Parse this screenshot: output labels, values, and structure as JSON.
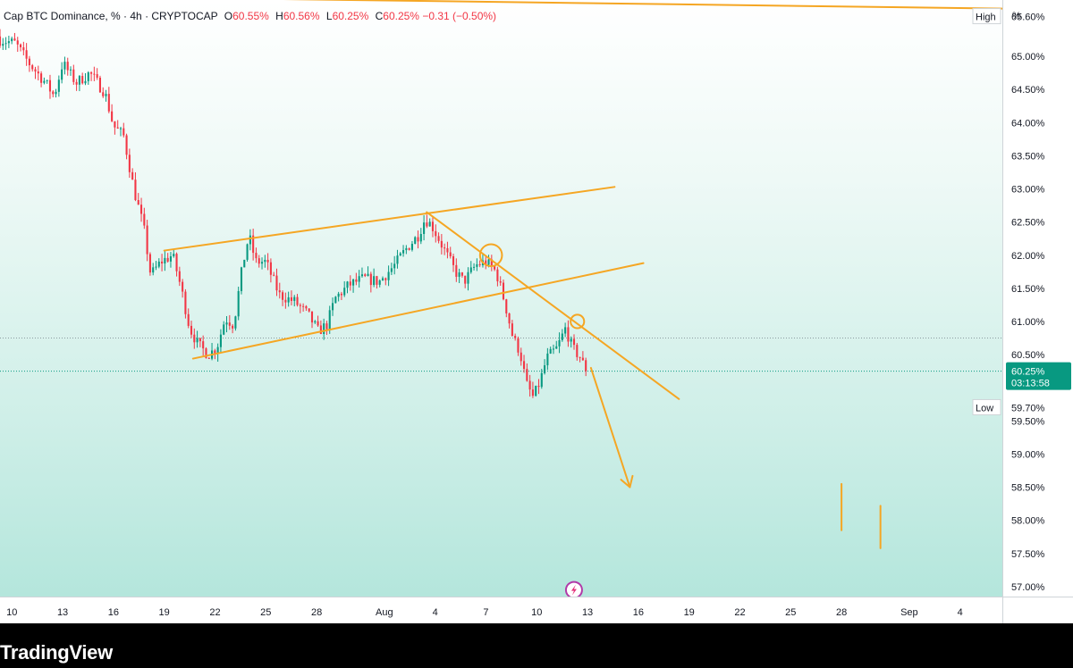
{
  "legend": {
    "title": "Cap BTC Dominance, % · 4h · CRYPTOCAP",
    "open_key": "O",
    "open": "60.55%",
    "high_key": "H",
    "high": "60.56%",
    "low_key": "L",
    "low": "60.25%",
    "close_key": "C",
    "close": "60.25%",
    "change": "−0.31 (−0.50%)"
  },
  "price_axis": {
    "unit": "%",
    "ticks": [
      "65.60%",
      "65.00%",
      "64.50%",
      "64.00%",
      "63.50%",
      "63.00%",
      "62.50%",
      "62.00%",
      "61.50%",
      "61.00%",
      "60.50%",
      "59.70%",
      "59.50%",
      "59.00%",
      "58.50%",
      "58.00%",
      "57.50%",
      "57.00%"
    ],
    "tick_values": [
      65.6,
      65.0,
      64.5,
      64.0,
      63.5,
      63.0,
      62.5,
      62.0,
      61.5,
      61.0,
      60.5,
      59.7,
      59.5,
      59.0,
      58.5,
      58.0,
      57.5,
      57.0
    ],
    "high_tag": {
      "label": "High",
      "value": 65.6
    },
    "low_tag": {
      "label": "Low",
      "value": 59.7
    },
    "last_price_tag": {
      "price": "60.25%",
      "countdown": "03:13:58",
      "value": 60.25,
      "color": "#089981"
    }
  },
  "time_axis": {
    "labels": [
      "10",
      "13",
      "16",
      "19",
      "22",
      "25",
      "28",
      "Aug",
      "4",
      "7",
      "10",
      "13",
      "16",
      "19",
      "22",
      "25",
      "28",
      "Sep",
      "4"
    ],
    "label_days": [
      10,
      13,
      16,
      19,
      22,
      25,
      28,
      32,
      35,
      38,
      41,
      44,
      47,
      50,
      53,
      56,
      59,
      63,
      66
    ]
  },
  "branding": {
    "text": "TradingView"
  },
  "colors": {
    "up": "#089981",
    "down": "#f23645",
    "drawing": "#f5a623",
    "last_price": "#089981"
  },
  "chart_data": {
    "type": "candlestick",
    "title": "Cap BTC Dominance, % · 4h · CRYPTOCAP",
    "ylabel": "%",
    "ylim": [
      56.85,
      65.85
    ],
    "xlim": [
      9.3,
      68.5
    ],
    "x_unit": "day of July (Aug 1 = 32)",
    "path_points": [
      [
        9.3,
        65.25
      ],
      [
        10.2,
        65.2
      ],
      [
        11.0,
        64.9
      ],
      [
        12.0,
        64.6
      ],
      [
        12.5,
        64.4
      ],
      [
        13.0,
        64.9
      ],
      [
        13.8,
        64.6
      ],
      [
        14.6,
        64.75
      ],
      [
        15.5,
        64.45
      ],
      [
        16.0,
        63.95
      ],
      [
        16.6,
        63.8
      ],
      [
        17.2,
        63.0
      ],
      [
        17.8,
        62.4
      ],
      [
        18.2,
        61.7
      ],
      [
        18.8,
        61.9
      ],
      [
        19.5,
        62.0
      ],
      [
        20.0,
        61.5
      ],
      [
        20.5,
        60.9
      ],
      [
        21.0,
        60.65
      ],
      [
        21.6,
        60.5
      ],
      [
        22.1,
        60.6
      ],
      [
        22.6,
        61.05
      ],
      [
        23.1,
        60.95
      ],
      [
        23.6,
        61.8
      ],
      [
        24.0,
        62.3
      ],
      [
        24.4,
        61.9
      ],
      [
        25.0,
        61.9
      ],
      [
        25.8,
        61.4
      ],
      [
        26.7,
        61.3
      ],
      [
        27.5,
        61.1
      ],
      [
        28.1,
        60.85
      ],
      [
        28.6,
        60.95
      ],
      [
        29.1,
        61.35
      ],
      [
        29.9,
        61.55
      ],
      [
        30.8,
        61.65
      ],
      [
        31.7,
        61.6
      ],
      [
        32.6,
        61.85
      ],
      [
        33.3,
        62.1
      ],
      [
        34.0,
        62.3
      ],
      [
        34.4,
        62.55
      ],
      [
        34.8,
        62.45
      ],
      [
        35.5,
        62.1
      ],
      [
        36.2,
        61.75
      ],
      [
        36.7,
        61.6
      ],
      [
        37.4,
        61.85
      ],
      [
        38.0,
        61.9
      ],
      [
        38.6,
        61.75
      ],
      [
        39.1,
        61.3
      ],
      [
        39.6,
        60.75
      ],
      [
        40.0,
        60.55
      ],
      [
        40.4,
        60.05
      ],
      [
        40.8,
        59.85
      ],
      [
        41.2,
        60.1
      ],
      [
        41.6,
        60.45
      ],
      [
        42.2,
        60.6
      ],
      [
        42.7,
        60.9
      ],
      [
        43.1,
        60.6
      ],
      [
        43.6,
        60.45
      ],
      [
        43.9,
        60.25
      ]
    ],
    "candle_count": 200,
    "last_close": 60.25,
    "period_high": 65.6,
    "period_low": 59.7,
    "current_price_line": 60.25,
    "reference_line": 60.75,
    "annotations": [
      {
        "type": "trendline",
        "from": [
          19.0,
          62.07
        ],
        "to": [
          45.6,
          63.03
        ]
      },
      {
        "type": "trendline",
        "from": [
          20.7,
          60.44
        ],
        "to": [
          47.3,
          61.88
        ]
      },
      {
        "type": "trendline",
        "from": [
          34.5,
          62.65
        ],
        "to": [
          49.4,
          59.83
        ]
      },
      {
        "type": "trendline",
        "from": [
          9.3,
          65.92
        ],
        "to": [
          68.5,
          65.72
        ]
      },
      {
        "type": "circle",
        "center": [
          38.3,
          62.0
        ],
        "radius_days": 0.65
      },
      {
        "type": "circle",
        "center": [
          43.4,
          61.0
        ],
        "radius_days": 0.4
      },
      {
        "type": "arrow",
        "from": [
          44.2,
          60.3
        ],
        "to": [
          46.5,
          58.5
        ]
      },
      {
        "type": "segment",
        "from": [
          59.0,
          58.55
        ],
        "to": [
          59.0,
          57.85
        ]
      },
      {
        "type": "segment",
        "from": [
          61.3,
          58.22
        ],
        "to": [
          61.3,
          57.58
        ]
      },
      {
        "type": "marker",
        "icon": "lightning-icon",
        "at": [
          43.2,
          56.95
        ]
      }
    ]
  }
}
